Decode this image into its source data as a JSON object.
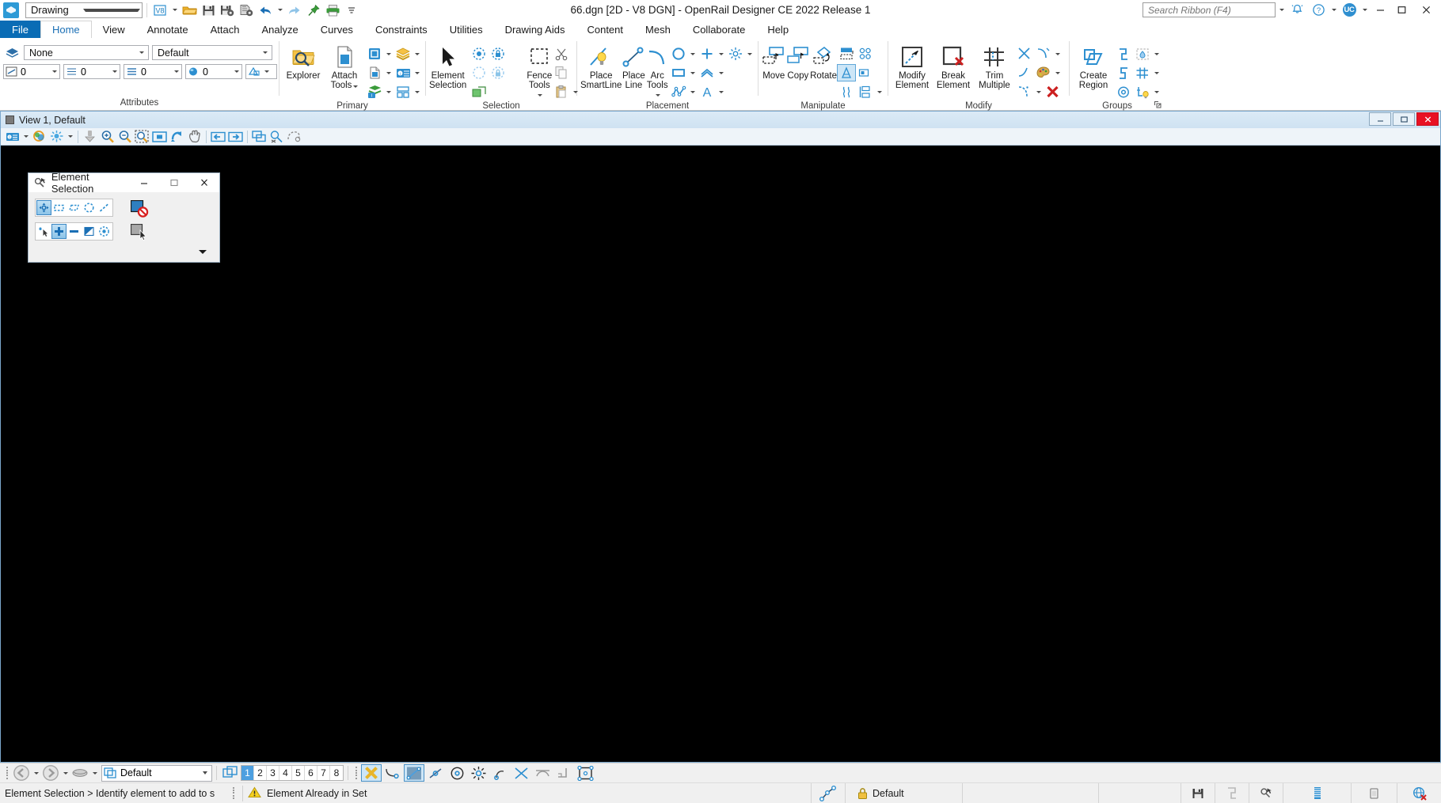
{
  "window": {
    "title": "66.dgn [2D - V8 DGN] - OpenRail Designer CE 2022 Release 1",
    "minimize_label": "–",
    "restore_label": "□",
    "close_label": "✕"
  },
  "quick_access": {
    "workflow_value": "Drawing",
    "buttons": [
      {
        "name": "dgn-format-icon",
        "label": "V8"
      },
      {
        "name": "open-file-icon",
        "label": "Open"
      },
      {
        "name": "save-icon",
        "label": "Save"
      },
      {
        "name": "save-settings-icon",
        "label": "Save Settings"
      },
      {
        "name": "save-as-icon",
        "label": "Save As"
      },
      {
        "name": "undo-icon",
        "label": "Undo"
      },
      {
        "name": "redo-icon",
        "label": "Redo"
      },
      {
        "name": "pin-icon",
        "label": "Pin"
      },
      {
        "name": "print-icon",
        "label": "Print"
      },
      {
        "name": "more-icon",
        "label": "More"
      }
    ]
  },
  "search": {
    "placeholder": "Search Ribbon (F4)",
    "value": ""
  },
  "title_right": {
    "notifications_label": "Notifications",
    "help_label": "Help",
    "user_initials": "UC"
  },
  "ribbon": {
    "tabs": [
      {
        "label": "File",
        "kind": "file"
      },
      {
        "label": "Home",
        "kind": "active"
      },
      {
        "label": "View",
        "kind": "normal"
      },
      {
        "label": "Annotate",
        "kind": "normal"
      },
      {
        "label": "Attach",
        "kind": "normal"
      },
      {
        "label": "Analyze",
        "kind": "normal"
      },
      {
        "label": "Curves",
        "kind": "normal"
      },
      {
        "label": "Constraints",
        "kind": "normal"
      },
      {
        "label": "Utilities",
        "kind": "normal"
      },
      {
        "label": "Drawing Aids",
        "kind": "normal"
      },
      {
        "label": "Content",
        "kind": "normal"
      },
      {
        "label": "Mesh",
        "kind": "normal"
      },
      {
        "label": "Collaborate",
        "kind": "normal"
      },
      {
        "label": "Help",
        "kind": "normal"
      }
    ],
    "groups": {
      "attributes": {
        "label": "Attributes",
        "level_value": "None",
        "color_value": "Default",
        "line_weight_value": "0",
        "line_style_value": "0",
        "transparency_value": "0",
        "priority_value": "0",
        "element_template_label": "Element Template"
      },
      "primary": {
        "label": "Primary",
        "explorer_label": "Explorer",
        "attach_tools_label": "Attach Tools",
        "items": [
          {
            "name": "models-icon",
            "label": "Models"
          },
          {
            "name": "level-manager-icon",
            "label": "Level Manager"
          },
          {
            "name": "properties-icon",
            "label": "Properties"
          },
          {
            "name": "level-display-icon",
            "label": "Level Display"
          },
          {
            "name": "reference-icon",
            "label": "Reference"
          },
          {
            "name": "raster-manager-icon",
            "label": "Raster Manager"
          }
        ]
      },
      "selection": {
        "label": "Selection",
        "element_selection_label": "Element Selection",
        "fence_tools_label": "Fence Tools",
        "items": [
          {
            "name": "select-all-icon",
            "label": "Select All"
          },
          {
            "name": "select-none-icon",
            "label": "Select None"
          },
          {
            "name": "select-by-attributes-icon",
            "label": "Select By Attributes"
          },
          {
            "name": "lock-icon",
            "label": "Lock"
          },
          {
            "name": "cut-icon",
            "label": "Cut"
          },
          {
            "name": "copy-icon",
            "label": "Copy"
          },
          {
            "name": "paste-icon",
            "label": "Paste"
          }
        ]
      },
      "placement": {
        "label": "Placement",
        "place_smartline_label": "Place SmartLine",
        "place_line_label": "Place Line",
        "arc_tools_label": "Arc Tools",
        "items": [
          {
            "name": "place-circle-icon",
            "label": "Place Circle"
          },
          {
            "name": "place-point-icon",
            "label": "Place Point"
          },
          {
            "name": "place-pattern-icon",
            "label": "Place Pattern"
          },
          {
            "name": "place-block-icon",
            "label": "Place Block"
          },
          {
            "name": "place-multiline-icon",
            "label": "Place Multi-line"
          },
          {
            "name": "place-polygon-icon",
            "label": "Place Polygon"
          },
          {
            "name": "place-text-icon",
            "label": "Place Text"
          }
        ]
      },
      "manipulate": {
        "label": "Manipulate",
        "move_label": "Move",
        "copy_label": "Copy",
        "rotate_label": "Rotate",
        "items": [
          {
            "name": "mirror-icon",
            "label": "Mirror"
          },
          {
            "name": "array-icon",
            "label": "Array"
          },
          {
            "name": "scale-icon",
            "label": "Scale"
          },
          {
            "name": "stretch-icon",
            "label": "Stretch"
          },
          {
            "name": "align-icon",
            "label": "Align"
          },
          {
            "name": "construct-icon",
            "label": "Construct"
          }
        ]
      },
      "modify": {
        "label": "Modify",
        "modify_element_label": "Modify Element",
        "break_element_label": "Break Element",
        "trim_multiple_label": "Trim Multiple",
        "items": [
          {
            "name": "trim-to-intersection-icon",
            "label": "Trim To Intersection"
          },
          {
            "name": "extend-line-icon",
            "label": "Extend Line"
          },
          {
            "name": "insert-vertex-icon",
            "label": "Insert Vertex"
          },
          {
            "name": "construct-fillet-icon",
            "label": "Construct Fillet"
          },
          {
            "name": "change-attributes-icon",
            "label": "Change Element Attributes"
          },
          {
            "name": "delete-element-icon",
            "label": "Delete Element"
          }
        ]
      },
      "groups": {
        "label": "Groups",
        "create_region_label": "Create Region",
        "items": [
          {
            "name": "group-icon",
            "label": "Group"
          },
          {
            "name": "add-to-graphic-group-icon",
            "label": "Add To Graphic Group"
          },
          {
            "name": "ungroup-icon",
            "label": "Ungroup"
          },
          {
            "name": "group-hole-icon",
            "label": "Group Hole"
          },
          {
            "name": "drop-element-icon",
            "label": "Drop Element"
          },
          {
            "name": "named-group-icon",
            "label": "Named Group"
          }
        ]
      }
    }
  },
  "view_window": {
    "title": "View 1, Default",
    "minimize_label": "–",
    "maximize_label": "□",
    "close_label": "✕",
    "toolbar": [
      {
        "name": "view-attributes-icon",
        "label": "View Attributes"
      },
      {
        "name": "adjust-view-brightness-icon",
        "label": "Adjust View Brightness"
      },
      {
        "name": "view-display-mode-icon",
        "label": "Display Style"
      },
      {
        "name": "update-view-icon",
        "label": "Update View"
      },
      {
        "name": "zoom-in-icon",
        "label": "Zoom In"
      },
      {
        "name": "zoom-out-icon",
        "label": "Zoom Out"
      },
      {
        "name": "window-area-icon",
        "label": "Window Area"
      },
      {
        "name": "fit-view-icon",
        "label": "Fit View"
      },
      {
        "name": "rotate-view-icon",
        "label": "Rotate View"
      },
      {
        "name": "pan-view-icon",
        "label": "Pan View"
      },
      {
        "name": "view-previous-icon",
        "label": "View Previous"
      },
      {
        "name": "view-next-icon",
        "label": "View Next"
      },
      {
        "name": "copy-view-icon",
        "label": "Copy View"
      },
      {
        "name": "clip-volume-icon",
        "label": "Clip Volume"
      },
      {
        "name": "clip-mask-icon",
        "label": "Clip Mask"
      }
    ]
  },
  "element_selection_dialog": {
    "title": "Element Selection",
    "minimize_label": "–",
    "maximize_label": "□",
    "close_label": "✕",
    "method_buttons": [
      {
        "name": "select-individual-icon",
        "label": "Individual",
        "selected": true
      },
      {
        "name": "select-block-icon",
        "label": "Block",
        "selected": false
      },
      {
        "name": "select-shape-icon",
        "label": "Shape",
        "selected": false
      },
      {
        "name": "select-circle-icon",
        "label": "Circle",
        "selected": false
      },
      {
        "name": "select-line-icon",
        "label": "Line",
        "selected": false
      }
    ],
    "mode_buttons": [
      {
        "name": "mode-new-icon",
        "label": "New",
        "selected": false
      },
      {
        "name": "mode-add-icon",
        "label": "Add",
        "selected": true
      },
      {
        "name": "mode-subtract-icon",
        "label": "Subtract",
        "selected": false
      },
      {
        "name": "mode-invert-icon",
        "label": "Invert",
        "selected": false
      },
      {
        "name": "mode-clear-icon",
        "label": "Clear All",
        "selected": false
      }
    ],
    "expand_label": "Show more"
  },
  "bottom_toolbar": {
    "back_label": "Back",
    "forward_label": "Forward",
    "models_label": "Models",
    "model_value": "Default",
    "level_numbers": [
      "1",
      "2",
      "3",
      "4",
      "5",
      "6",
      "7",
      "8"
    ],
    "active_level": "1",
    "snap_buttons": [
      {
        "name": "snap-none-icon",
        "label": "No Snap",
        "selected": true
      },
      {
        "name": "snap-nearest-icon",
        "label": "Nearest",
        "selected": false
      },
      {
        "name": "snap-keypoint-icon",
        "label": "Keypoint",
        "selected": true
      },
      {
        "name": "snap-midpoint-icon",
        "label": "Midpoint",
        "selected": false
      },
      {
        "name": "snap-center-icon",
        "label": "Center",
        "selected": false
      },
      {
        "name": "snap-origin-icon",
        "label": "Origin",
        "selected": false
      },
      {
        "name": "snap-bisector-icon",
        "label": "Bisector",
        "selected": false
      },
      {
        "name": "snap-intersection-icon",
        "label": "Intersection",
        "selected": false
      },
      {
        "name": "snap-tangent-icon",
        "label": "Tangent",
        "selected": false
      },
      {
        "name": "snap-perpendicular-icon",
        "label": "Perpendicular",
        "selected": false
      },
      {
        "name": "snap-point-on-icon",
        "label": "Point On",
        "selected": false
      }
    ]
  },
  "status_bar": {
    "prompt": "Element Selection > Identify element to add to s",
    "message": "Element Already in Set",
    "warning_icon": "warning-icon",
    "level_value": "Default",
    "right_icons": [
      {
        "name": "snap-mode-icon",
        "label": "Snap Mode"
      },
      {
        "name": "lock-icon",
        "label": "Locks"
      },
      {
        "name": "save-status-icon",
        "label": "File Changed"
      },
      {
        "name": "fence-status-icon",
        "label": "Fence"
      },
      {
        "name": "selection-status-icon",
        "label": "Selection Set"
      },
      {
        "name": "tasks-icon",
        "label": "Tasks"
      },
      {
        "name": "print-status-icon",
        "label": "Print"
      },
      {
        "name": "connect-status-icon",
        "label": "Not Connected"
      }
    ]
  },
  "colors": {
    "accent": "#0a6cb5",
    "icon_blue": "#1a8cd8",
    "close_red": "#e81123",
    "canvas": "#000000"
  }
}
